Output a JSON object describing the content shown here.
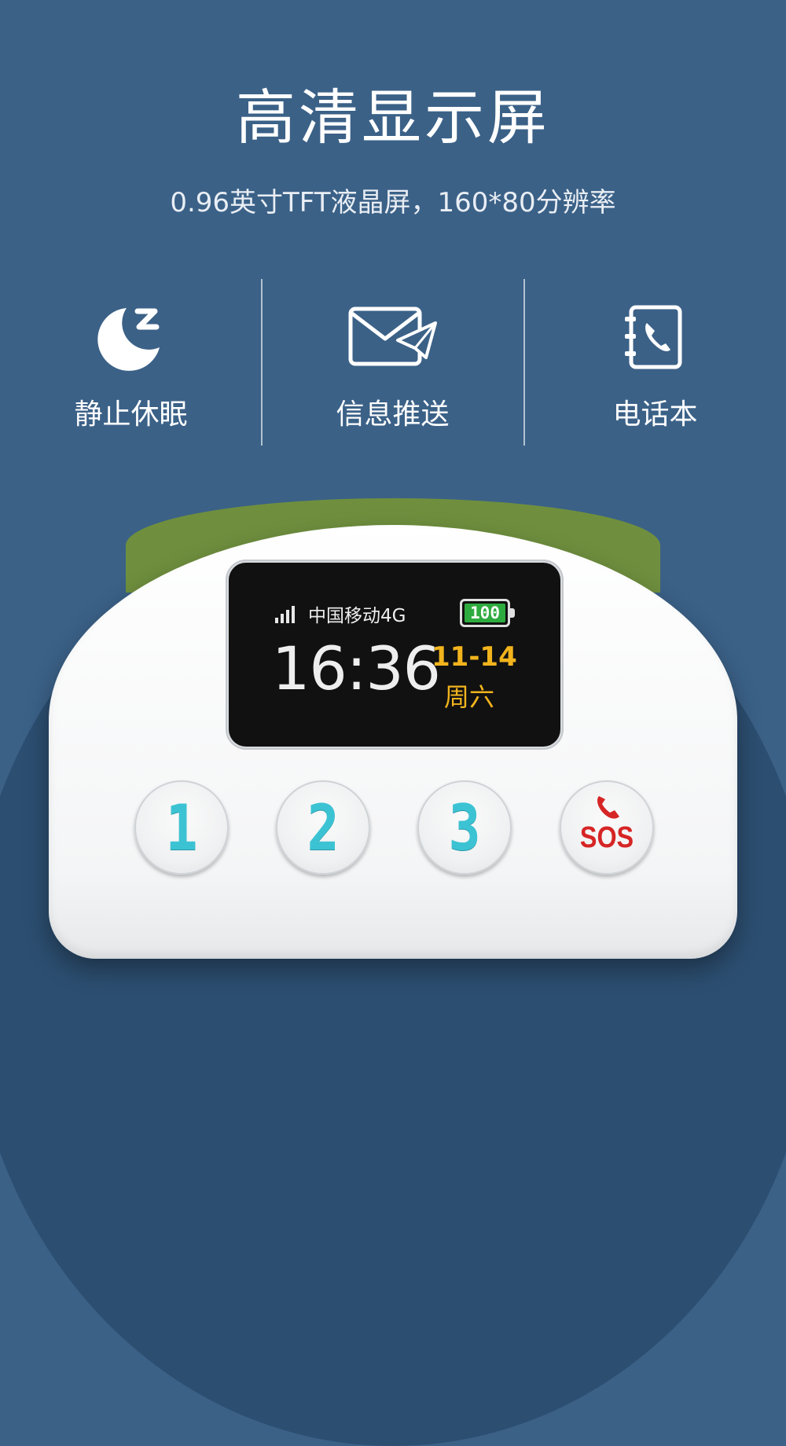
{
  "header": {
    "title": "高清显示屏",
    "subtitle": "0.96英寸TFT液晶屏，160*80分辨率"
  },
  "features": [
    {
      "icon": "moon-sleep-icon",
      "label": "静止休眠"
    },
    {
      "icon": "envelope-send-icon",
      "label": "信息推送"
    },
    {
      "icon": "phonebook-icon",
      "label": "电话本"
    }
  ],
  "device_screen": {
    "carrier": "中国移动4G",
    "battery": "100",
    "time": "16:36",
    "date": "11-14",
    "weekday": "周六"
  },
  "keys": [
    {
      "label": "1"
    },
    {
      "label": "2"
    },
    {
      "label": "3"
    },
    {
      "label": "SOS",
      "icon": "phone-handset-icon"
    }
  ],
  "colors": {
    "background": "#3b6187",
    "key_digit": "#3cc3d3",
    "sos_red": "#d62525",
    "date_yellow": "#f2b41d",
    "battery_green": "#2eab3f"
  }
}
